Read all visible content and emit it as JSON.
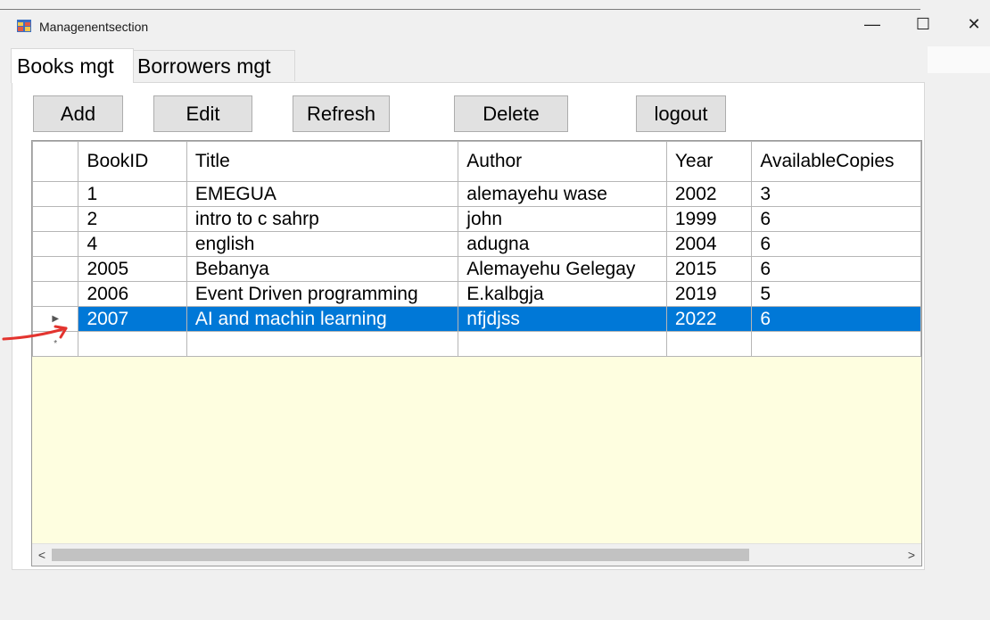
{
  "window": {
    "title": "Managenentsection",
    "minimize_glyph": "—",
    "maximize_glyph": "☐",
    "close_glyph": "✕"
  },
  "tabs": [
    {
      "label": "Books mgt",
      "active": true
    },
    {
      "label": "Borrowers mgt",
      "active": false
    }
  ],
  "toolbar": {
    "add_label": "Add",
    "edit_label": "Edit",
    "refresh_label": "Refresh",
    "delete_label": "Delete",
    "logout_label": "logout"
  },
  "grid": {
    "columns": [
      "BookID",
      "Title",
      "Author",
      "Year",
      "AvailableCopies"
    ],
    "rows": [
      [
        "1",
        "EMEGUA",
        "alemayehu wase",
        "2002",
        "3"
      ],
      [
        "2",
        "intro to c sahrp",
        "john",
        "1999",
        "6"
      ],
      [
        "4",
        "english",
        "adugna",
        "2004",
        "6"
      ],
      [
        "2005",
        "Bebanya",
        "Alemayehu Gelegay",
        "2015",
        "6"
      ],
      [
        "2006",
        "Event Driven programming",
        "E.kalbgja",
        "2019",
        "5"
      ],
      [
        "2007",
        "AI and machin learning",
        "nfjdjss",
        "2022",
        "6"
      ]
    ],
    "selected_row": 5,
    "current_row_glyph": "▶",
    "new_row_glyph": "*",
    "scroll_left_glyph": "<",
    "scroll_right_glyph": ">"
  },
  "colors": {
    "selection": "#0078d7",
    "grid_background": "#fefee0",
    "annotation_arrow": "#e3342f"
  },
  "icons": {
    "app": "window-app-icon",
    "annotation": "red-arrow-annotation"
  }
}
